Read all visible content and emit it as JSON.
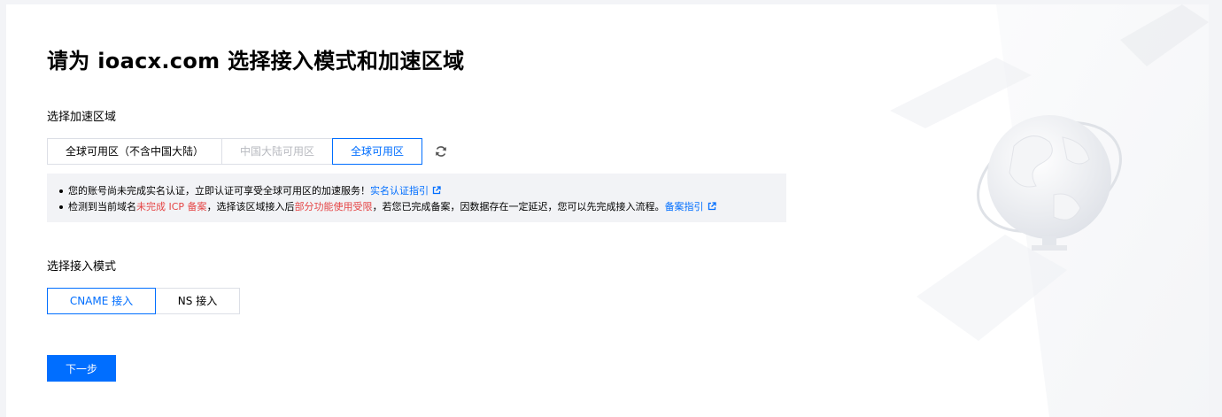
{
  "page": {
    "title": "请为 ioacx.com 选择接入模式和加速区域"
  },
  "region": {
    "label": "选择加速区域",
    "options": [
      {
        "label": "全球可用区（不含中国大陆）",
        "state": "normal"
      },
      {
        "label": "中国大陆可用区",
        "state": "disabled"
      },
      {
        "label": "全球可用区",
        "state": "selected"
      }
    ],
    "refresh_icon": "refresh-icon"
  },
  "notice": {
    "line1": {
      "text": "您的账号尚未完成实名认证，立即认证可享受全球可用区的加速服务！",
      "link": "实名认证指引"
    },
    "line2": {
      "part1": "检测到当前域名",
      "red1": "未完成 ICP 备案",
      "part2": "，选择该区域接入后",
      "red2": "部分功能使用受限",
      "part3": "，若您已完成备案，因数据存在一定延迟，您可以先完成接入流程。",
      "link": "备案指引"
    }
  },
  "mode": {
    "label": "选择接入模式",
    "options": [
      {
        "label": "CNAME 接入",
        "state": "selected"
      },
      {
        "label": "NS 接入",
        "state": "normal"
      }
    ]
  },
  "actions": {
    "next_label": "下一步"
  },
  "colors": {
    "accent": "#006eff",
    "warning": "#e54545",
    "notice_bg": "#f2f3f6"
  }
}
